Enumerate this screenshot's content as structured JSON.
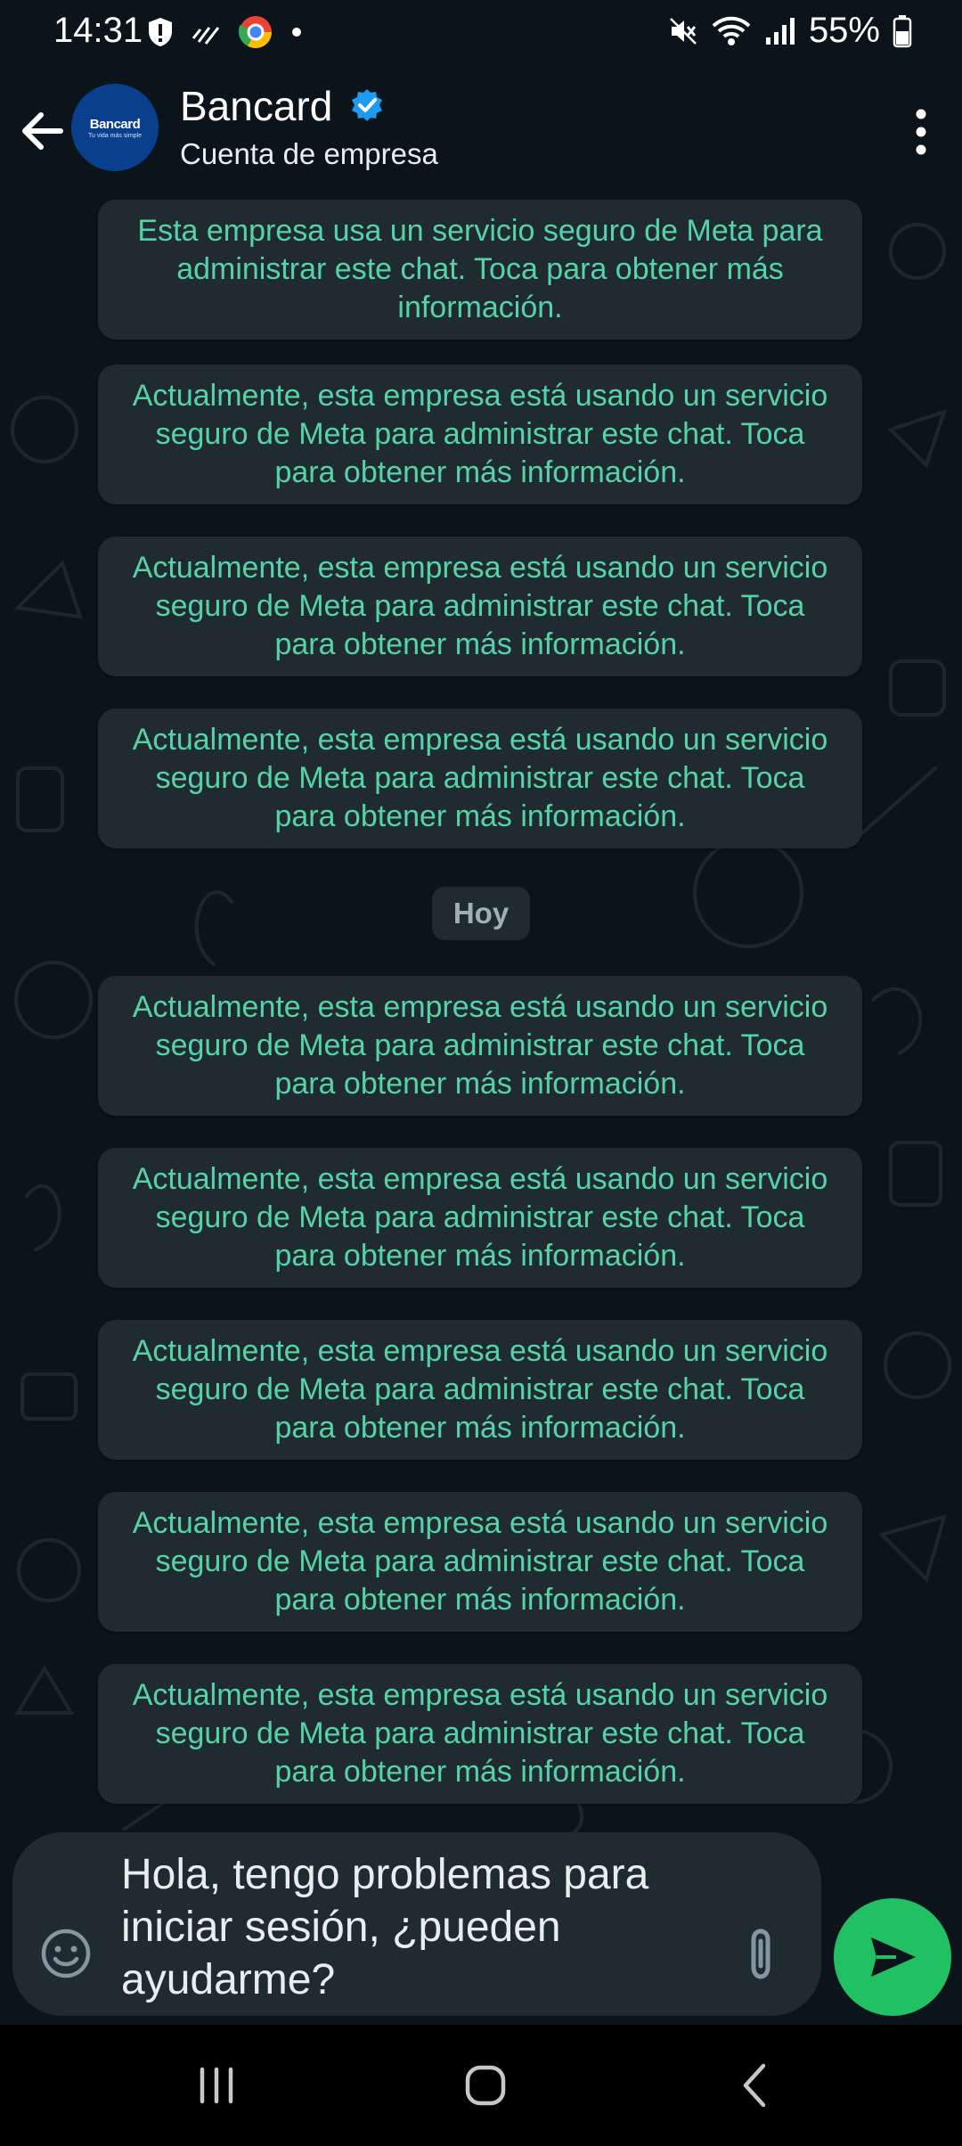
{
  "status_bar": {
    "time": "14:31",
    "battery": "55%",
    "icons": [
      "shield-alert-icon",
      "signal-activity-icon",
      "chrome-app-icon",
      "notification-dot-icon",
      "mute-icon",
      "wifi-icon",
      "cell-signal-icon",
      "battery-icon"
    ]
  },
  "header": {
    "name": "Bancard",
    "subtitle": "Cuenta de empresa",
    "avatar_brand": "Bancard",
    "avatar_tagline": "Tu vida más simple",
    "verified": true
  },
  "chat": {
    "first_notice": "Esta empresa usa un servicio seguro de Meta para administrar este chat. Toca para obtener más información.",
    "notices_before": [
      "Actualmente, esta empresa está usando un servicio seguro de Meta para administrar este chat. Toca para obtener más información.",
      "Actualmente, esta empresa está usando un servicio seguro de Meta para administrar este chat. Toca para obtener más información.",
      "Actualmente, esta empresa está usando un servicio seguro de Meta para administrar este chat. Toca para obtener más información."
    ],
    "day_label": "Hoy",
    "notices_after": [
      "Actualmente, esta empresa está usando un servicio seguro de Meta para administrar este chat. Toca para obtener más información.",
      "Actualmente, esta empresa está usando un servicio seguro de Meta para administrar este chat. Toca para obtener más información.",
      "Actualmente, esta empresa está usando un servicio seguro de Meta para administrar este chat. Toca para obtener más información.",
      "Actualmente, esta empresa está usando un servicio seguro de Meta para administrar este chat. Toca para obtener más información.",
      "Actualmente, esta empresa está usando un servicio seguro de Meta para administrar este chat. Toca para obtener más información."
    ]
  },
  "composer": {
    "text": "Hola, tengo problemas para iniciar sesión, ¿pueden ayudarme?"
  },
  "colors": {
    "background": "#0b141a",
    "bubble": "#1f2b31",
    "notice_text": "#56d3a5",
    "send": "#21c063",
    "verified": "#1d9bf0"
  }
}
